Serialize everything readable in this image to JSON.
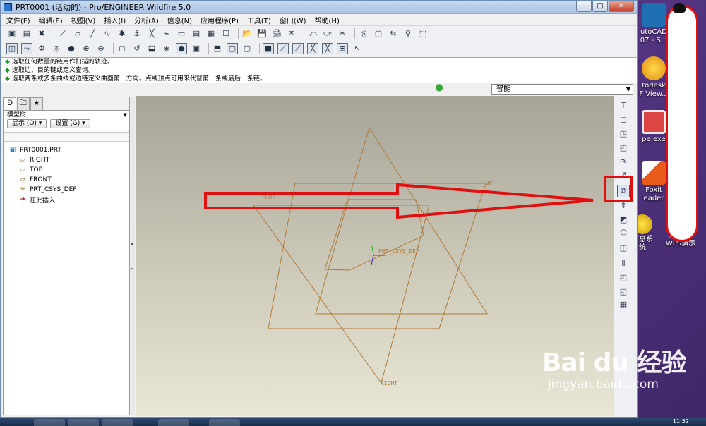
{
  "window": {
    "title": "PRT0001 (活动的) - Pro/ENGINEER Wildfire 5.0",
    "min_label": "–",
    "max_label": "□",
    "close_label": "✕"
  },
  "menu": {
    "items": [
      "文件(F)",
      "编辑(E)",
      "视图(V)",
      "插入(I)",
      "分析(A)",
      "信息(N)",
      "应用程序(P)",
      "工具(T)",
      "窗口(W)",
      "帮助(H)"
    ]
  },
  "toolbar1": [
    "▣",
    "▤",
    "✖",
    "⟋",
    "▱",
    "╱",
    "∿",
    "✱",
    "⚓",
    "╳",
    "⌁",
    "▭",
    "▤",
    "▦",
    "☐",
    "📂",
    "💾",
    "🖨",
    "✉",
    "⤺",
    "⤻",
    "✂",
    "⎘",
    "▢",
    "⇆",
    "⚲",
    "⬚"
  ],
  "toolbar2": [
    "◫",
    "⤳",
    "⚙",
    "◎",
    "●",
    "⊕",
    "⊖",
    "◻",
    "↺",
    "⬓",
    "◈",
    "●",
    "▣",
    "⬒",
    "▢",
    "▢",
    "■",
    "⟋",
    "⟋",
    "╳",
    "╳",
    "⊞",
    "↖"
  ],
  "messages": [
    "选取任何数量的链用作扫描的轨迹。",
    "选取边、目的链或定义查询。",
    "选取两条或多条曲线或边链定义曲面第一方向。点或顶点可用来代替第一条或最后一条链。"
  ],
  "filter": {
    "value": "智能"
  },
  "navigator": {
    "header": "模型树",
    "show_button": "显示 (O) ▾",
    "settings_button": "设置 (G) ▾",
    "tree": {
      "root": "PRT0001.PRT",
      "children": [
        {
          "label": "RIGHT",
          "icon": "datum-plane-icon"
        },
        {
          "label": "TOP",
          "icon": "datum-plane-icon"
        },
        {
          "label": "FRONT",
          "icon": "datum-plane-icon"
        },
        {
          "label": "PRT_CSYS_DEF",
          "icon": "csys-icon"
        },
        {
          "label": "在此插入",
          "icon": "insert-here-icon"
        }
      ]
    }
  },
  "graphics": {
    "labels": {
      "top": "TOP",
      "front": "FRONT",
      "right": "RIGHT",
      "csys": "PRT_CSYS_DEF"
    },
    "line_color": "#b07a3a",
    "arrow_color": "#e01010"
  },
  "right_tools": [
    "⊤",
    "◻",
    "◳",
    "◰",
    "↷",
    "↗",
    "⧉",
    "⇕",
    "◩",
    "⬠",
    "◫",
    "⫴",
    "◰",
    "◱",
    "▦"
  ],
  "desktop": {
    "icons": [
      {
        "label": "utoCAD\n07 - S..."
      },
      {
        "label": "todesk\nF View..."
      },
      {
        "label": "pe.exe"
      },
      {
        "label": "Foxit\neader"
      },
      {
        "label": "信息系\n统"
      },
      {
        "label": "WPS演示"
      }
    ]
  },
  "watermark": {
    "brand": "Bai du 经验",
    "url": "jingyan.baidu.com"
  },
  "taskbar": {
    "clock": "11:52"
  }
}
